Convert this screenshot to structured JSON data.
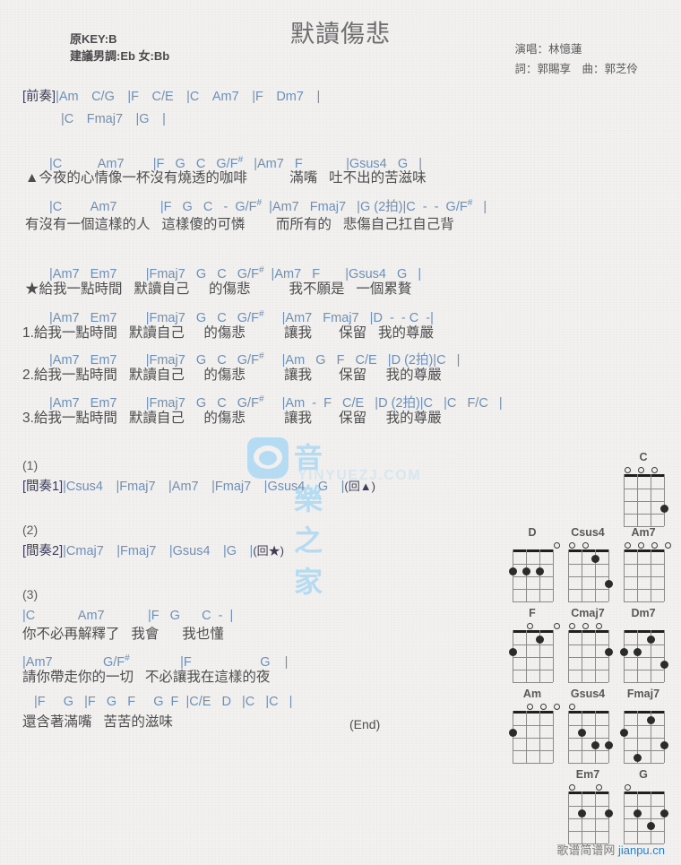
{
  "header": {
    "title": "默讀傷悲",
    "key_line1": "原KEY:B",
    "key_line2": "建議男調:Eb 女:Bb",
    "singer": "演唱：林憶蓮",
    "writers": "詞：郭賜享　曲：郭芝伶"
  },
  "watermark": {
    "brand": "音樂之家",
    "site": "YINYUEZJ.COM"
  },
  "footer": {
    "site_cn": "歌谱简谱网",
    "site_url": "jianpu.cn"
  },
  "sections": {
    "intro_label": "[前奏]",
    "intro_line1": "|Am　C/G　|F　C/E　|C　Am7　|F　Dm7　|",
    "intro_line2": "|C　Fmaj7　|G　|",
    "interlude1_label": "[間奏1]",
    "interlude1_chords": "|Csus4　|Fmaj7　|Am7　|Fmaj7　|Gsus4　G　|",
    "interlude1_repeat": "(回▲)",
    "interlude2_label": "[間奏2]",
    "interlude2_chords": "|Cmaj7　|Fmaj7　|Gsus4　|G　|",
    "interlude2_repeat": "(回★)",
    "num1": "(1)",
    "num2": "(2)",
    "num3": "(3)",
    "end_marker": "(End)"
  },
  "verse1": {
    "chords_a": "|C          Am7        |F   G   C   G/F#   |Am7   F            |Gsus4   G   |",
    "lyrics_a": "▲今夜的心情像一杯沒有燒透的咖啡           滿嘴   吐不出的苦滋味",
    "chords_b": "|C        Am7            |F   G   C   -  G/F#  |Am7   Fmaj7   |G (2拍)|C  -  -  G/F#   |",
    "lyrics_b": "有沒有一個這樣的人   這樣傻的可憐        而所有的   悲傷自己扛自己背"
  },
  "chorus": {
    "chords_star": "|Am7   Em7        |Fmaj7   G   C   G/F#  |Am7   F       |Gsus4   G   |",
    "lyrics_star": "★給我一點時間   默讀自己     的傷悲          我不願是   一個累贅",
    "chords_1": "|Am7   Em7        |Fmaj7   G   C   G/F#     |Am7   Fmaj7   |D  -  - C  -|",
    "lyrics_1": "1.給我一點時間   默讀自己     的傷悲          讓我       保留   我的尊嚴",
    "chords_2": "|Am7   Em7        |Fmaj7   G   C   G/F#     |Am   G   F   C/E   |D (2拍)|C   |",
    "lyrics_2": "2.給我一點時間   默讀自己     的傷悲          讓我       保留     我的尊嚴",
    "chords_3": "|Am7   Em7        |Fmaj7   G   C   G/F#     |Am  -  F   C/E   |D (2拍)|C   |C   F/C   |",
    "lyrics_3": "3.給我一點時間   默讀自己     的傷悲          讓我       保留     我的尊嚴"
  },
  "bridge": {
    "chords_a": "|C            Am7            |F   G      C  -  |",
    "lyrics_a": "你不必再解釋了   我會      我也懂",
    "chords_b": "|Am7              G/F#              |F                   G    |",
    "lyrics_b": "請你帶走你的一切   不必讓我在這樣的夜",
    "chords_c": "|F     G   |F   G   F     G  F  |C/E   D   |C   |C   |",
    "lyrics_c": "還含著滿嘴   苦苦的滋味"
  },
  "chord_diagrams": [
    {
      "name": "C",
      "open": [
        0,
        1,
        2
      ],
      "dots": [
        {
          "string": 3,
          "fret": 3
        }
      ]
    },
    {
      "name": "D",
      "open": [
        3
      ],
      "dots": [
        {
          "string": 0,
          "fret": 2
        },
        {
          "string": 1,
          "fret": 2
        },
        {
          "string": 2,
          "fret": 2
        }
      ]
    },
    {
      "name": "Csus4",
      "open": [
        0,
        1
      ],
      "dots": [
        {
          "string": 2,
          "fret": 1
        },
        {
          "string": 3,
          "fret": 3
        }
      ]
    },
    {
      "name": "Am7",
      "open": [
        0,
        1,
        2,
        3
      ],
      "dots": []
    },
    {
      "name": "F",
      "open": [
        1,
        3
      ],
      "dots": [
        {
          "string": 2,
          "fret": 1
        },
        {
          "string": 0,
          "fret": 2
        }
      ]
    },
    {
      "name": "Cmaj7",
      "open": [
        0,
        1,
        2
      ],
      "dots": [
        {
          "string": 3,
          "fret": 2
        }
      ]
    },
    {
      "name": "Dm7",
      "open": [],
      "dots": [
        {
          "string": 2,
          "fret": 1
        },
        {
          "string": 0,
          "fret": 2
        },
        {
          "string": 1,
          "fret": 2
        },
        {
          "string": 3,
          "fret": 3
        }
      ]
    },
    {
      "name": "Am",
      "open": [
        1,
        2,
        3
      ],
      "dots": [
        {
          "string": 0,
          "fret": 2
        }
      ]
    },
    {
      "name": "Gsus4",
      "open": [
        0
      ],
      "dots": [
        {
          "string": 1,
          "fret": 2
        },
        {
          "string": 2,
          "fret": 3
        },
        {
          "string": 3,
          "fret": 3
        }
      ]
    },
    {
      "name": "Fmaj7",
      "open": [],
      "dots": [
        {
          "string": 2,
          "fret": 1
        },
        {
          "string": 0,
          "fret": 2
        },
        {
          "string": 3,
          "fret": 3
        },
        {
          "string": 1,
          "fret": 4
        }
      ]
    },
    {
      "name": "Em7",
      "open": [
        0,
        2
      ],
      "dots": [
        {
          "string": 1,
          "fret": 2
        },
        {
          "string": 3,
          "fret": 2
        }
      ]
    },
    {
      "name": "G",
      "open": [
        0
      ],
      "dots": [
        {
          "string": 1,
          "fret": 2
        },
        {
          "string": 3,
          "fret": 2
        },
        {
          "string": 2,
          "fret": 3
        }
      ]
    }
  ]
}
